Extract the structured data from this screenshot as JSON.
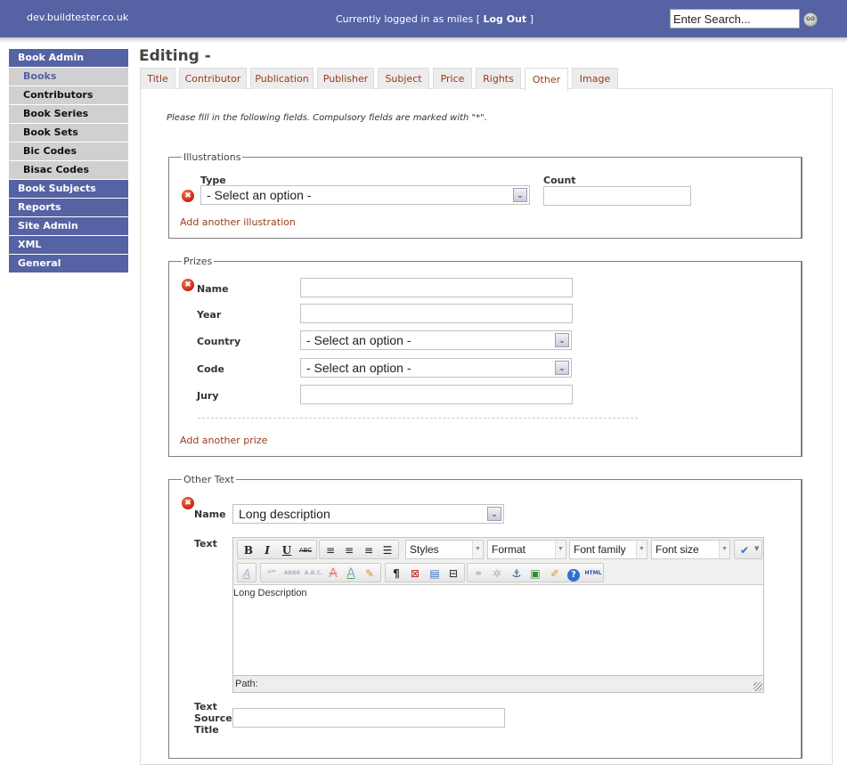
{
  "header": {
    "site_name": "dev.buildtester.co.uk",
    "login_prefix": "Currently logged in as miles [ ",
    "logout_label": "Log Out",
    "login_suffix": " ]",
    "search_placeholder": "Enter Search...",
    "go_label": "GO"
  },
  "sidebar": {
    "items": [
      {
        "label": "Book Admin",
        "type": "main"
      },
      {
        "label": "Books",
        "type": "sub",
        "active": true
      },
      {
        "label": "Contributors",
        "type": "sub"
      },
      {
        "label": "Book Series",
        "type": "sub"
      },
      {
        "label": "Book Sets",
        "type": "sub"
      },
      {
        "label": "Bic Codes",
        "type": "sub"
      },
      {
        "label": "Bisac Codes",
        "type": "sub"
      },
      {
        "label": "Book Subjects",
        "type": "main"
      },
      {
        "label": "Reports",
        "type": "main"
      },
      {
        "label": "Site Admin",
        "type": "main"
      },
      {
        "label": "XML",
        "type": "main"
      },
      {
        "label": "General",
        "type": "main"
      }
    ]
  },
  "page": {
    "title": "Editing -",
    "instructions": "Please fill in the following fields. Compulsory fields are marked with \"*\".",
    "tabs": [
      "Title",
      "Contributor",
      "Publication",
      "Publisher",
      "Subject",
      "Price",
      "Rights",
      "Other",
      "Image"
    ],
    "active_tab": "Other"
  },
  "illustrations": {
    "legend": "Illustrations",
    "type_label": "Type",
    "type_value": "- Select an option -",
    "count_label": "Count",
    "count_value": "",
    "add_link": "Add another illustration"
  },
  "prizes": {
    "legend": "Prizes",
    "name_label": "Name",
    "name_value": "",
    "year_label": "Year",
    "year_value": "",
    "country_label": "Country",
    "country_value": "- Select an option -",
    "code_label": "Code",
    "code_value": "- Select an option -",
    "jury_label": "Jury",
    "jury_value": "",
    "add_link": "Add another prize"
  },
  "other_text": {
    "legend": "Other Text",
    "name_label": "Name",
    "name_value": "Long description",
    "text_label": "Text",
    "editor": {
      "styles": "Styles",
      "format": "Format",
      "font_family": "Font family",
      "font_size": "Font size",
      "content": "Long Description",
      "status": "Path:"
    },
    "source_title_label": "Text Source Title",
    "source_title_value": ""
  },
  "icons": {
    "error": "✖",
    "dropdown": "⌄",
    "bold": "B",
    "italic": "I",
    "underline": "U",
    "strike": "ABC",
    "paragraph": "¶",
    "anchor": "⚓",
    "help": "?",
    "html": "HTML"
  }
}
